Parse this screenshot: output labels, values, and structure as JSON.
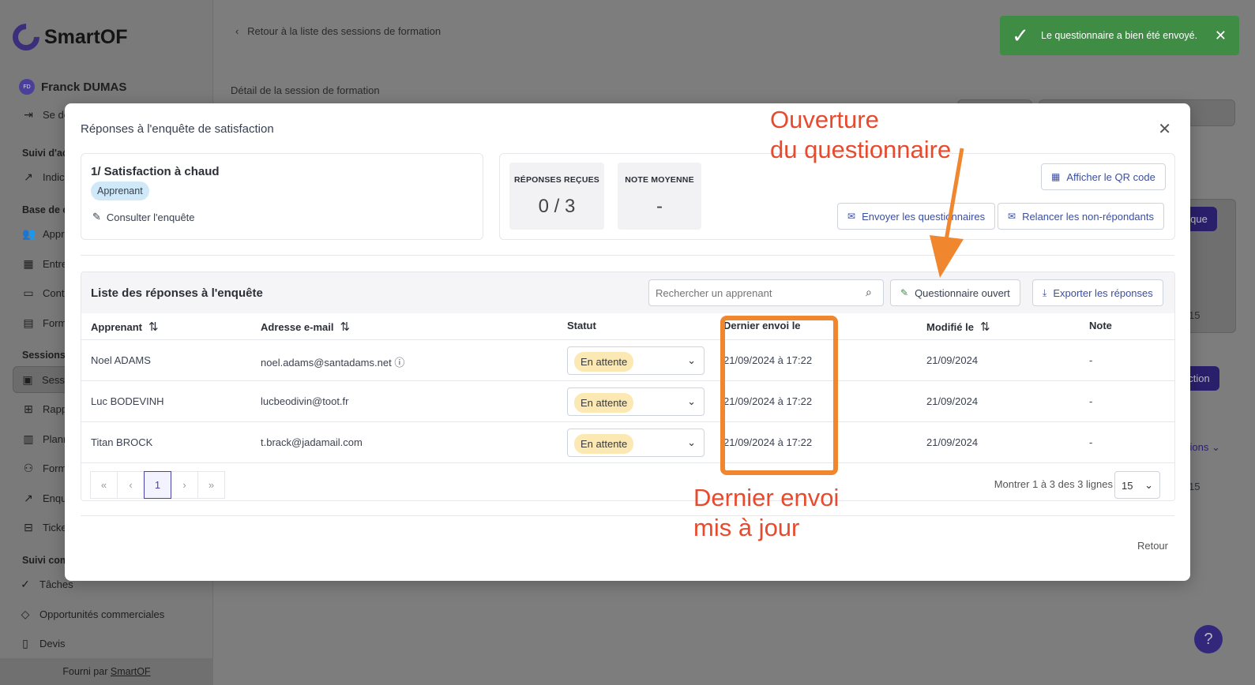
{
  "brand": {
    "name": "SmartOF"
  },
  "user": {
    "initials": "FD",
    "name": "Franck DUMAS"
  },
  "sidebar": {
    "items": [
      {
        "label": "Se dé",
        "icon": "logout-icon"
      },
      {
        "label": "Suivi d'ac",
        "section": true
      },
      {
        "label": "Indica",
        "icon": "chart-icon"
      },
      {
        "label": "Base de c",
        "section": true
      },
      {
        "label": "Appre",
        "icon": "users-icon"
      },
      {
        "label": "Entre",
        "icon": "building-icon"
      },
      {
        "label": "Conta",
        "icon": "contact-icon"
      },
      {
        "label": "Form",
        "icon": "book-icon"
      },
      {
        "label": "Sessions",
        "section": true
      },
      {
        "label": "Sessi",
        "icon": "calendar-icon",
        "active": true
      },
      {
        "label": "Rapp",
        "icon": "grid-icon"
      },
      {
        "label": "Planr",
        "icon": "map-icon"
      },
      {
        "label": "Form",
        "icon": "user-icon"
      },
      {
        "label": "Enqu",
        "icon": "chart-icon"
      },
      {
        "label": "Ticke",
        "icon": "ticket-icon"
      },
      {
        "label": "Suivi com",
        "section": true
      },
      {
        "label": "Tâches",
        "icon": "check-circle-icon"
      },
      {
        "label": "Opportunités commerciales",
        "icon": "tag-icon"
      },
      {
        "label": "Devis",
        "icon": "document-icon"
      }
    ],
    "footer_prefix": "Fourni par",
    "footer_link": "SmartOF"
  },
  "background": {
    "back_link": "Retour à la liste des sessions de formation",
    "detail_label": "Détail de la session de formation",
    "btn_logique": "gique",
    "btn_action": "action",
    "link_sessions": "sions",
    "pagesize_a": "15",
    "pagesize_b": "15"
  },
  "toast": {
    "message": "Le questionnaire a bien été envoyé.",
    "color": "#3f8d45"
  },
  "modal": {
    "title": "Réponses à l'enquête de satisfaction",
    "survey": {
      "title": "1/ Satisfaction à chaud",
      "audience": "Apprenant",
      "consult_label": "Consulter l'enquête"
    },
    "stats": [
      {
        "label": "RÉPONSES REÇUES",
        "value": "0 / 3"
      },
      {
        "label": "NOTE MOYENNE",
        "value": "-"
      }
    ],
    "qr_button": "Afficher le QR code",
    "send_button": "Envoyer les questionnaires",
    "remind_button": "Relancer les non-répondants",
    "list_title": "Liste des réponses à l'enquête",
    "search_placeholder": "Rechercher un apprenant",
    "open_button": "Questionnaire ouvert",
    "export_button": "Exporter les réponses",
    "columns": [
      "Apprenant",
      "Adresse e-mail",
      "Statut",
      "Dernier envoi le",
      "Modifié le",
      "Note"
    ],
    "rows": [
      {
        "name": "Noel ADAMS",
        "email": "noel.adams@santadams.net",
        "status": "En attente",
        "last_sent": "21/09/2024 à 17:22",
        "modified": "21/09/2024",
        "note": "-"
      },
      {
        "name": "Luc BODEVINH",
        "email": "lucbeodivin@toot.fr",
        "status": "En attente",
        "last_sent": "21/09/2024 à 17:22",
        "modified": "21/09/2024",
        "note": "-"
      },
      {
        "name": "Titan BROCK",
        "email": "t.brack@jadamail.com",
        "status": "En attente",
        "last_sent": "21/09/2024 à 17:22",
        "modified": "21/09/2024",
        "note": "-"
      }
    ],
    "pagination": {
      "first": "«",
      "prev": "‹",
      "current": "1",
      "next": "›",
      "last": "»",
      "showing": "Montrer 1 à 3 des 3 lignes",
      "page_size": "15"
    },
    "retour": "Retour"
  },
  "annotations": {
    "open_line1": "Ouverture",
    "open_line2": "du questionnaire",
    "sent_line1": "Dernier envoi",
    "sent_line2": "mis à jour",
    "color": "#e84a2d",
    "highlight_color": "#f0862e"
  },
  "help": {
    "label": "?"
  }
}
